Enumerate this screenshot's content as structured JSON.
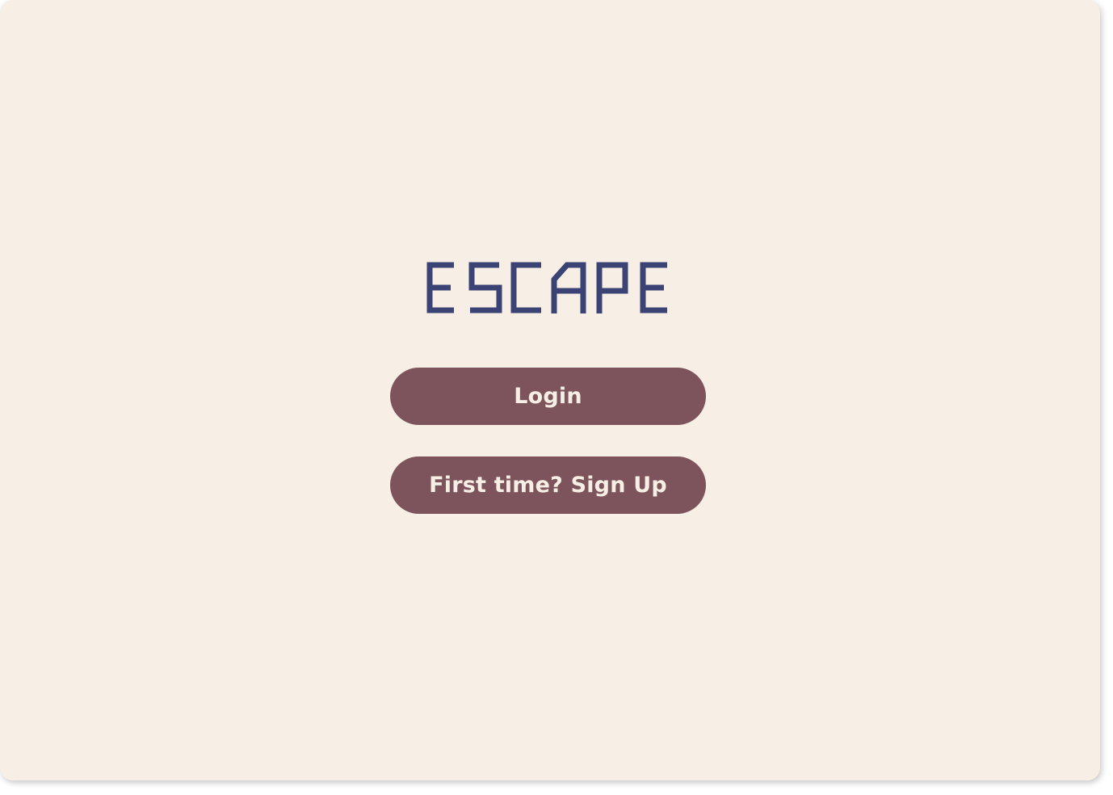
{
  "colors": {
    "background": "#f7efe6",
    "logo": "#3b4374",
    "button": "#7d545b",
    "button_text": "#f7efe6"
  },
  "app": {
    "logo_text": "ESCAPE"
  },
  "actions": {
    "login_label": "Login",
    "signup_label": "First time? Sign Up"
  }
}
